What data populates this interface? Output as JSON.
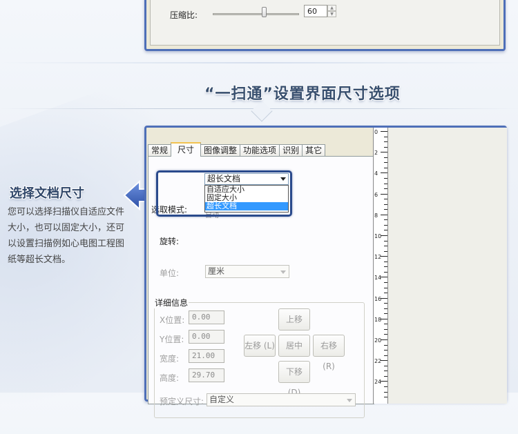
{
  "top_panel": {
    "compress_label": "压缩比:",
    "compress_value": "60",
    "slider_level": 0.6
  },
  "section_title": "“一扫通”设置界面尺寸选项",
  "caption": {
    "title": "选择文档尺寸",
    "body": "您可以选择扫描仪自适应文件大小，也可以固定大小，还可以设置扫描例如心电图工程图纸等超长文档。"
  },
  "tabs": [
    {
      "label": "常规",
      "active": false
    },
    {
      "label": "尺寸",
      "active": true
    },
    {
      "label": "图像调整",
      "active": false
    },
    {
      "label": "功能选项",
      "active": false
    },
    {
      "label": "识别",
      "active": false
    },
    {
      "label": "其它",
      "active": false
    }
  ],
  "size_tab": {
    "mode_label": "选取模式:",
    "mode_value": "超长文档",
    "mode_options": [
      "自适应大小",
      "固定大小",
      "超长文档"
    ],
    "mode_selected_index": 2,
    "rotate_label": "旋转:",
    "rotate_value_partial": "自动",
    "unit_label": "单位:",
    "unit_value": "厘米",
    "details_title": "详细信息",
    "x_label": "X位置:",
    "x_value": "0.00",
    "y_label": "Y位置:",
    "y_value": "0.00",
    "width_label": "宽度:",
    "width_value": "21.00",
    "height_label": "高度:",
    "height_value": "29.70",
    "up_button": "上移 (U)",
    "left_button": "左移 (L)",
    "center_button": "居中 (M)",
    "right_button": "右移 (R)",
    "down_button": "下移 (D)",
    "preset_label": "预定义尺寸:",
    "preset_value": "自定义"
  },
  "ruler": {
    "labels": [
      "0",
      "2",
      "4",
      "6",
      "8",
      "10",
      "12",
      "14",
      "16",
      "18",
      "20",
      "22",
      "24"
    ]
  },
  "colors": {
    "window_border": "#4e6fb8",
    "highlight_border": "#2a4a8c",
    "selection_blue": "#3399ff",
    "arrow_blue": "#3b5fb8",
    "title_color": "#39506f"
  }
}
